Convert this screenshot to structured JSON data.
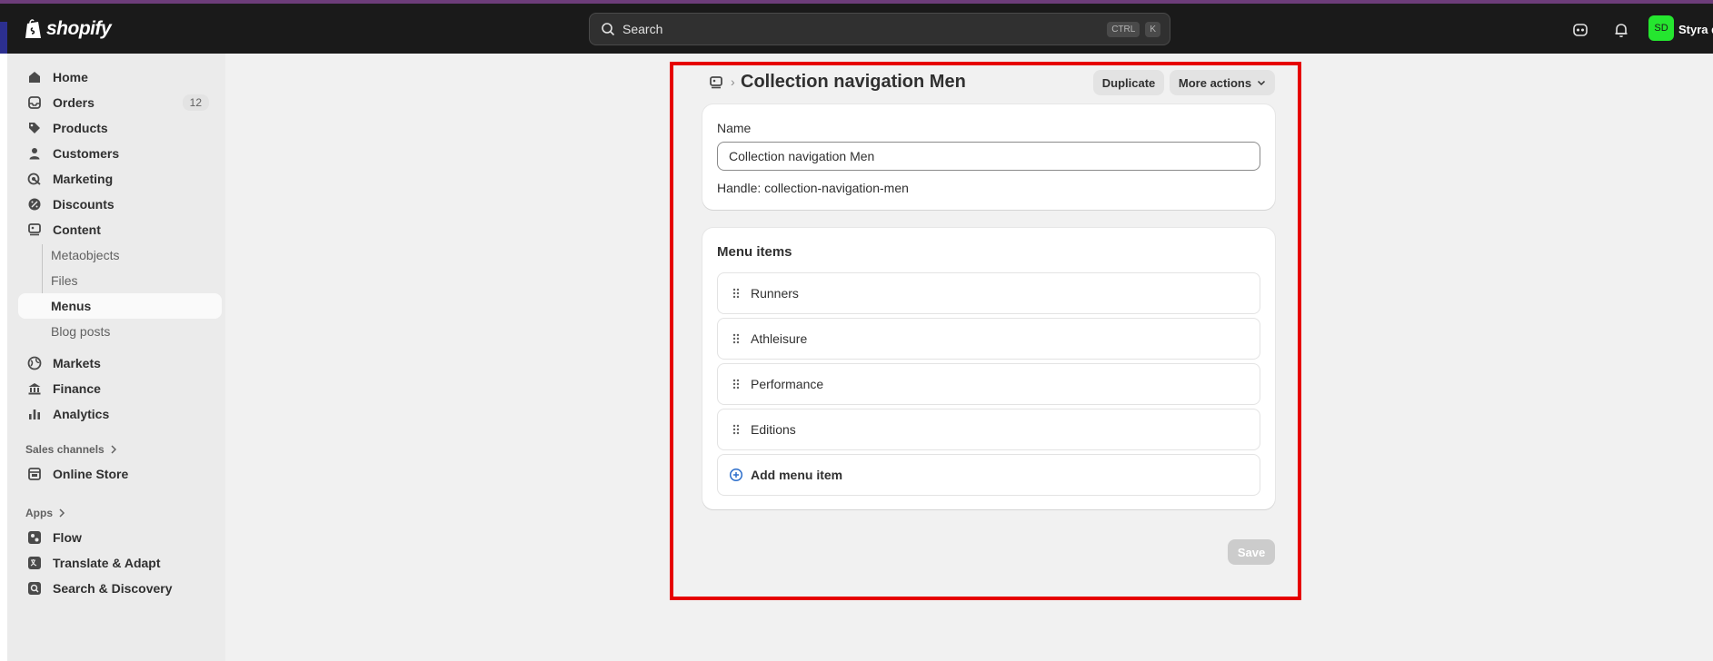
{
  "app": {
    "logo_text": "shopify",
    "avatar_initials": "SD",
    "store_name": "Styra d"
  },
  "search": {
    "placeholder": "Search",
    "shortcut_key1": "CTRL",
    "shortcut_key2": "K"
  },
  "sidebar": {
    "items": [
      {
        "label": "Home",
        "icon": "home-icon"
      },
      {
        "label": "Orders",
        "icon": "inbox-icon",
        "badge": "12"
      },
      {
        "label": "Products",
        "icon": "tag-icon"
      },
      {
        "label": "Customers",
        "icon": "person-icon"
      },
      {
        "label": "Marketing",
        "icon": "target-icon"
      },
      {
        "label": "Discounts",
        "icon": "discount-icon"
      },
      {
        "label": "Content",
        "icon": "content-icon"
      }
    ],
    "content_sub": [
      {
        "label": "Metaobjects"
      },
      {
        "label": "Files"
      },
      {
        "label": "Menus"
      },
      {
        "label": "Blog posts"
      }
    ],
    "items2": [
      {
        "label": "Markets",
        "icon": "globe-icon"
      },
      {
        "label": "Finance",
        "icon": "bank-icon"
      },
      {
        "label": "Analytics",
        "icon": "chart-icon"
      }
    ],
    "sales_channels_label": "Sales channels",
    "online_store": "Online Store",
    "apps_label": "Apps",
    "apps": [
      {
        "label": "Flow"
      },
      {
        "label": "Translate & Adapt"
      },
      {
        "label": "Search & Discovery"
      }
    ]
  },
  "page": {
    "title": "Collection navigation Men",
    "duplicate_label": "Duplicate",
    "more_actions_label": "More actions",
    "name_label": "Name",
    "name_value": "Collection navigation Men",
    "handle_text": "Handle: collection-navigation-men",
    "menu_items_title": "Menu items",
    "menu_items": [
      {
        "label": "Runners"
      },
      {
        "label": "Athleisure"
      },
      {
        "label": "Performance"
      },
      {
        "label": "Editions"
      }
    ],
    "add_menu_item_label": "Add menu item",
    "save_label": "Save"
  },
  "colors": {
    "highlight": "#e60000",
    "avatar": "#25e62f",
    "topbar": "#1a1a1a",
    "add_icon": "#2c6ecb"
  }
}
